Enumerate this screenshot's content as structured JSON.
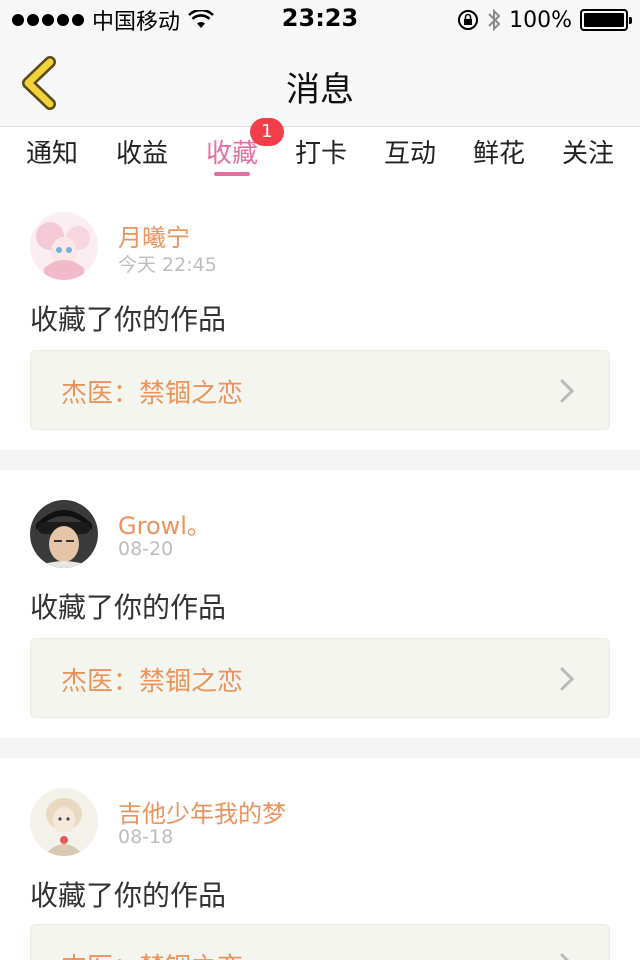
{
  "status_bar": {
    "carrier": "中国移动",
    "time": "23:23",
    "battery": "100%"
  },
  "nav": {
    "title": "消息",
    "back_icon": "chevron-left-icon"
  },
  "tabs": [
    {
      "label": "通知"
    },
    {
      "label": "收益"
    },
    {
      "label": "收藏",
      "active": true,
      "badge": "1"
    },
    {
      "label": "打卡"
    },
    {
      "label": "互动"
    },
    {
      "label": "鲜花"
    },
    {
      "label": "关注"
    }
  ],
  "messages": [
    {
      "user": "月曦宁",
      "time": "今天 22:45",
      "action": "收藏了你的作品",
      "work": "杰医：禁锢之恋"
    },
    {
      "user": "Growl。",
      "time": "08-20",
      "action": "收藏了你的作品",
      "work": "杰医：禁锢之恋"
    },
    {
      "user": "吉他少年我的梦",
      "time": "08-18",
      "action": "收藏了你的作品",
      "work": "杰医：禁锢之恋"
    }
  ],
  "colors": {
    "accent_pink": "#e46fa0",
    "username_orange": "#e9935f",
    "badge_red": "#f23d4a",
    "back_arrow_yellow": "#f2d33c"
  }
}
